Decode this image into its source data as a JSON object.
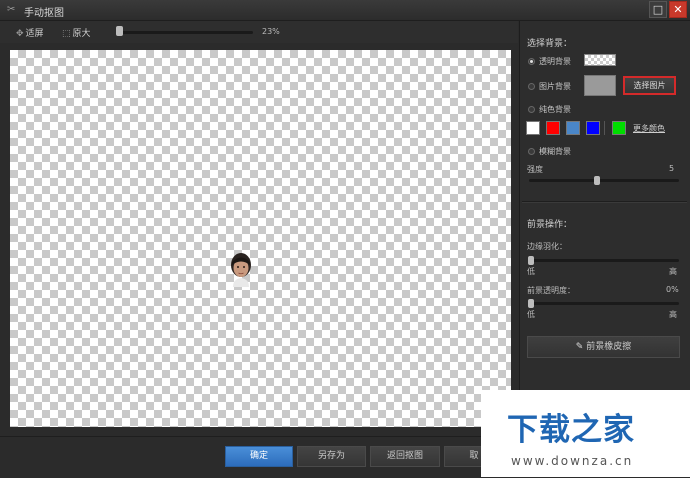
{
  "window": {
    "title": "手动抠图"
  },
  "toolbar": {
    "fit_label": "适屏",
    "original_label": "原大",
    "zoom_value": "23%",
    "zoom_fraction": 0.03
  },
  "sidebar": {
    "bg_section_title": "选择背景：",
    "bg_options": {
      "transparent": "透明背景",
      "image": "图片背景",
      "solid": "纯色背景",
      "blur": "模糊背景"
    },
    "select_image_label": "选择图片",
    "more_colors_label": "更多颜色",
    "colors": [
      "#ffffff",
      "#ff0000",
      "#4a86c8",
      "#0000ff",
      "#00dd00"
    ],
    "strength_label": "强度",
    "strength_value": "5",
    "strength_fraction": 0.45,
    "fg_section_title": "前景操作：",
    "feather_label": "边缘羽化：",
    "feather_low": "低",
    "feather_high": "高",
    "opacity_label": "前景透明度：",
    "opacity_value": "0%",
    "opacity_low": "低",
    "opacity_high": "高",
    "eraser_label": "前景橡皮擦"
  },
  "buttons": {
    "confirm": "确定",
    "save_as": "另存为",
    "back": "返回抠图",
    "cancel": "取"
  },
  "watermark": {
    "brand": "下载之家",
    "url": "www.downza.cn"
  }
}
